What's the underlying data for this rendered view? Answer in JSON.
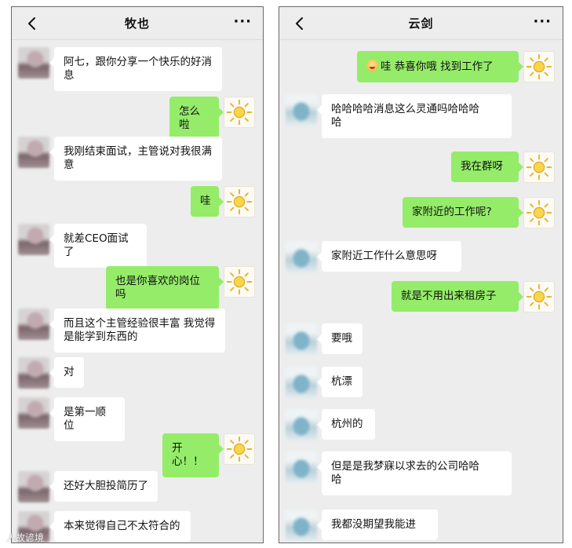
{
  "left_chat": {
    "title": "牧也",
    "more": "···",
    "messages": [
      {
        "side": "in",
        "avatar": "blurred-avatar",
        "text": "阿七，跟你分享一个快乐的好消\n息"
      },
      {
        "side": "out",
        "avatar": "sun-avatar",
        "text": "怎么啦"
      },
      {
        "side": "in",
        "avatar": "blurred-avatar",
        "text": "我刚结束面试，主管说对我很满\n意"
      },
      {
        "side": "out",
        "avatar": "sun-avatar",
        "text": "哇"
      },
      {
        "side": "in",
        "avatar": "blurred-avatar",
        "text": "就差CEO面试了"
      },
      {
        "side": "out",
        "avatar": "sun-avatar",
        "text": "也是你喜欢的岗位吗"
      },
      {
        "side": "in",
        "avatar": "blurred-avatar",
        "text": "而且这个主管经验很丰富 我觉得\n是能学到东西的"
      },
      {
        "side": "in",
        "avatar": "blurred-avatar",
        "text": "对"
      },
      {
        "side": "in",
        "avatar": "blurred-avatar",
        "text": "是第一顺位"
      },
      {
        "side": "out",
        "avatar": "sun-avatar",
        "text": "开心！！"
      },
      {
        "side": "in",
        "avatar": "blurred-avatar",
        "text": "还好大胆投简历了"
      },
      {
        "side": "in",
        "avatar": "blurred-avatar",
        "text": "本来觉得自己不太符合的"
      }
    ]
  },
  "right_chat": {
    "title": "云剑",
    "more": "···",
    "messages": [
      {
        "side": "out",
        "avatar": "sun-avatar",
        "emoji": "smiling-emoji",
        "text": "哇 恭喜你哦 找到工作了"
      },
      {
        "side": "in",
        "avatar": "cyan-avatar",
        "text": "哈哈哈哈消息这么灵通吗哈哈哈\n哈"
      },
      {
        "side": "out",
        "avatar": "sun-avatar",
        "text": "我在群呀"
      },
      {
        "side": "out",
        "avatar": "sun-avatar",
        "text": "家附近的工作呢?"
      },
      {
        "side": "in",
        "avatar": "cyan-avatar",
        "text": "家附近工作什么意思呀"
      },
      {
        "side": "out",
        "avatar": "sun-avatar",
        "text": "就是不用出来租房子"
      },
      {
        "side": "in",
        "avatar": "cyan-avatar",
        "text": "要哦"
      },
      {
        "side": "in",
        "avatar": "cyan-avatar",
        "text": "杭漂"
      },
      {
        "side": "in",
        "avatar": "cyan-avatar",
        "text": "杭州的"
      },
      {
        "side": "in",
        "avatar": "cyan-avatar",
        "text": "但是是我梦寐以求去的公司哈哈\n哈"
      },
      {
        "side": "in",
        "avatar": "cyan-avatar",
        "text": "我都没期望我能进"
      }
    ]
  },
  "watermark": "人故谚境"
}
